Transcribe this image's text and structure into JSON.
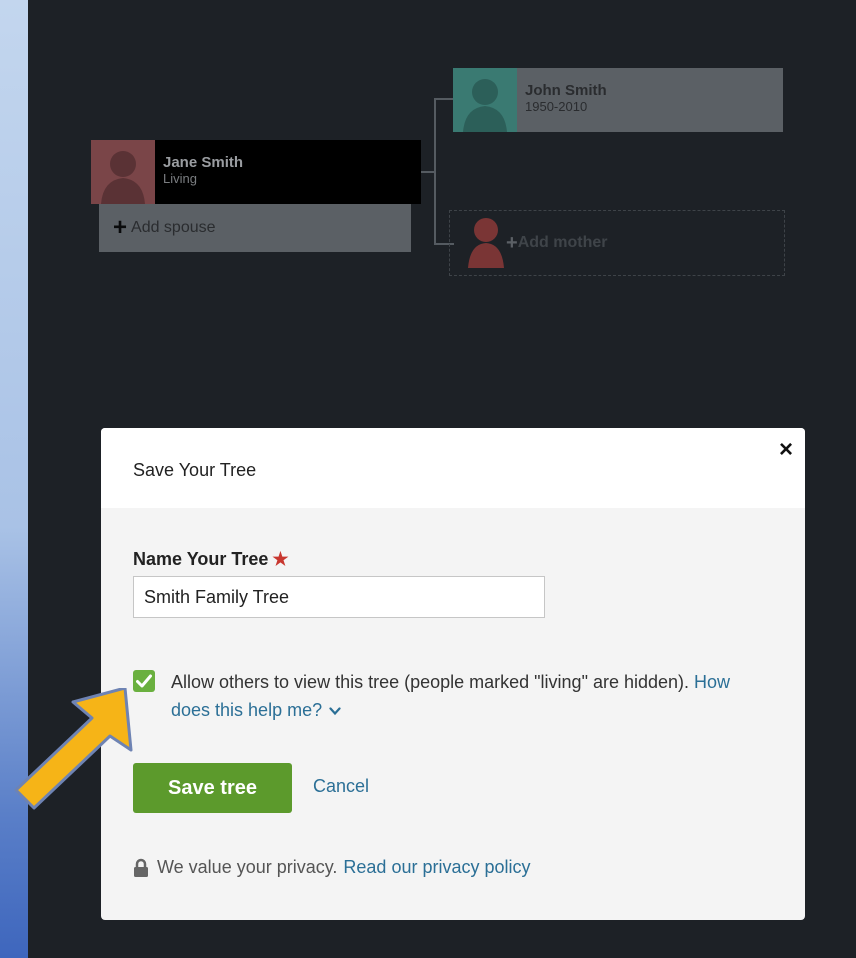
{
  "tree": {
    "father": {
      "name": "John Smith",
      "dates": "1950-2010"
    },
    "root": {
      "name": "Jane Smith",
      "status": "Living"
    },
    "add_spouse_label": "Add spouse",
    "add_mother_label": "Add mother"
  },
  "modal": {
    "title": "Save Your Tree",
    "close_label": "×",
    "field_label": "Name Your Tree",
    "required_mark": "★",
    "tree_name_value": "Smith Family Tree",
    "allow_label": "Allow others to view this tree (people marked \"living\" are hidden).",
    "allow_checked": true,
    "help_link": "How does this help me?",
    "save_label": "Save tree",
    "cancel_label": "Cancel",
    "privacy_text": "We value your privacy.",
    "privacy_link": "Read our privacy policy"
  },
  "colors": {
    "stage": "#1d2126",
    "save_button": "#5c9a2c",
    "link": "#2b6f96",
    "checkbox": "#6ab03f",
    "required": "#c8372f",
    "arrow": "#f6b417"
  },
  "icons": [
    "person-silhouette-icon",
    "plus-icon",
    "close-icon",
    "checkmark-icon",
    "chevron-down-icon",
    "lock-icon",
    "pointer-arrow"
  ]
}
